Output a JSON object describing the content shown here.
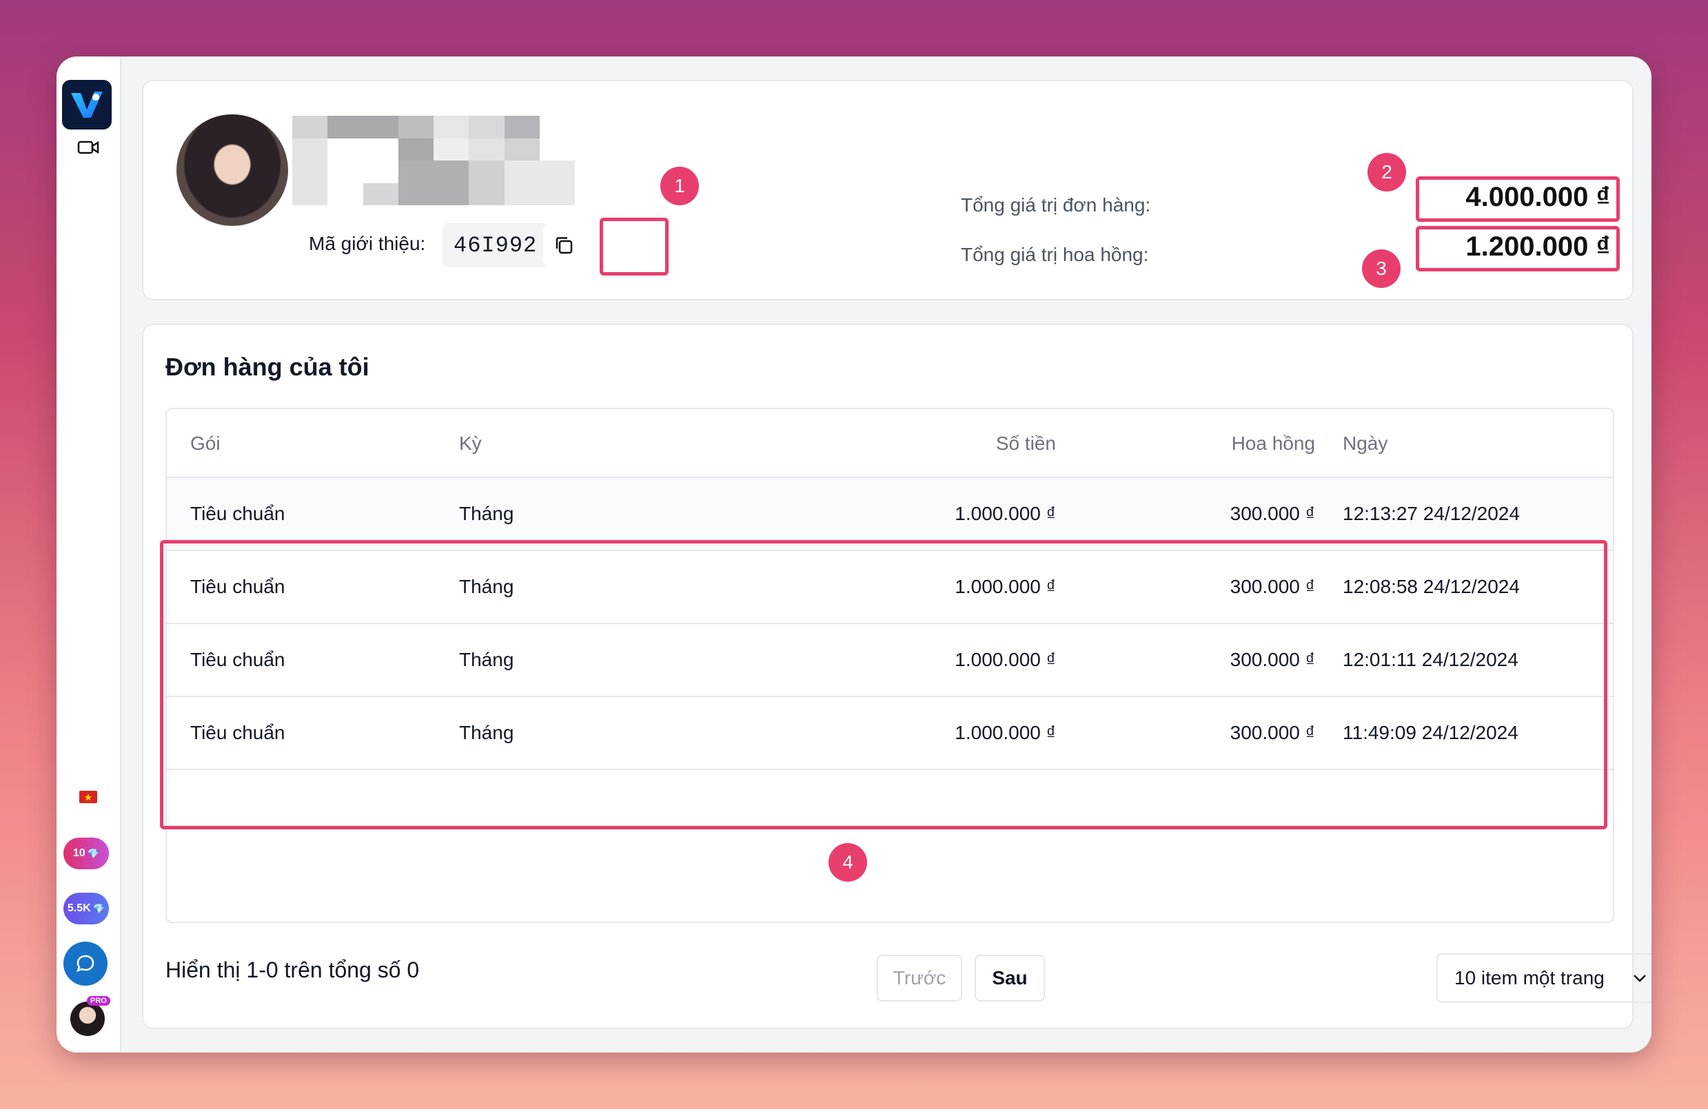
{
  "profile": {
    "referral_label": "Mã giới thiệu:",
    "referral_code": "46I992",
    "total_orders_label": "Tổng giá trị đơn hàng:",
    "total_orders_value": "4.000.000 ₫",
    "total_commission_label": "Tổng giá trị hoa hồng:",
    "total_commission_value": "1.200.000 ₫"
  },
  "annotations": {
    "m1": "1",
    "m2": "2",
    "m3": "3",
    "m4": "4"
  },
  "sidebar": {
    "badge_gems": "10",
    "badge_points": "5.5K",
    "pro_badge": "PRO"
  },
  "orders": {
    "title": "Đơn hàng của tôi",
    "columns": [
      "Gói",
      "Kỳ",
      "Số tiền",
      "Hoa hồng",
      "Ngày"
    ],
    "rows": [
      [
        "Tiêu chuẩn",
        "Tháng",
        "1.000.000 ₫",
        "300.000 ₫",
        "12:13:27 24/12/2024"
      ],
      [
        "Tiêu chuẩn",
        "Tháng",
        "1.000.000 ₫",
        "300.000 ₫",
        "12:08:58 24/12/2024"
      ],
      [
        "Tiêu chuẩn",
        "Tháng",
        "1.000.000 ₫",
        "300.000 ₫",
        "12:01:11 24/12/2024"
      ],
      [
        "Tiêu chuẩn",
        "Tháng",
        "1.000.000 ₫",
        "300.000 ₫",
        "11:49:09 24/12/2024"
      ]
    ]
  },
  "pagination": {
    "summary": "Hiển thị 1-0 trên tổng số 0",
    "prev_label": "Trước",
    "next_label": "Sau",
    "page_size_label": "10 item một trang"
  },
  "colors": {
    "highlight": "#e83e6d",
    "chat": "#1673c8"
  },
  "icons": [
    "logo-icon",
    "video-icon",
    "vietnam-flag-icon",
    "gem-icon",
    "chat-icon",
    "copy-icon",
    "chevron-down-icon"
  ]
}
